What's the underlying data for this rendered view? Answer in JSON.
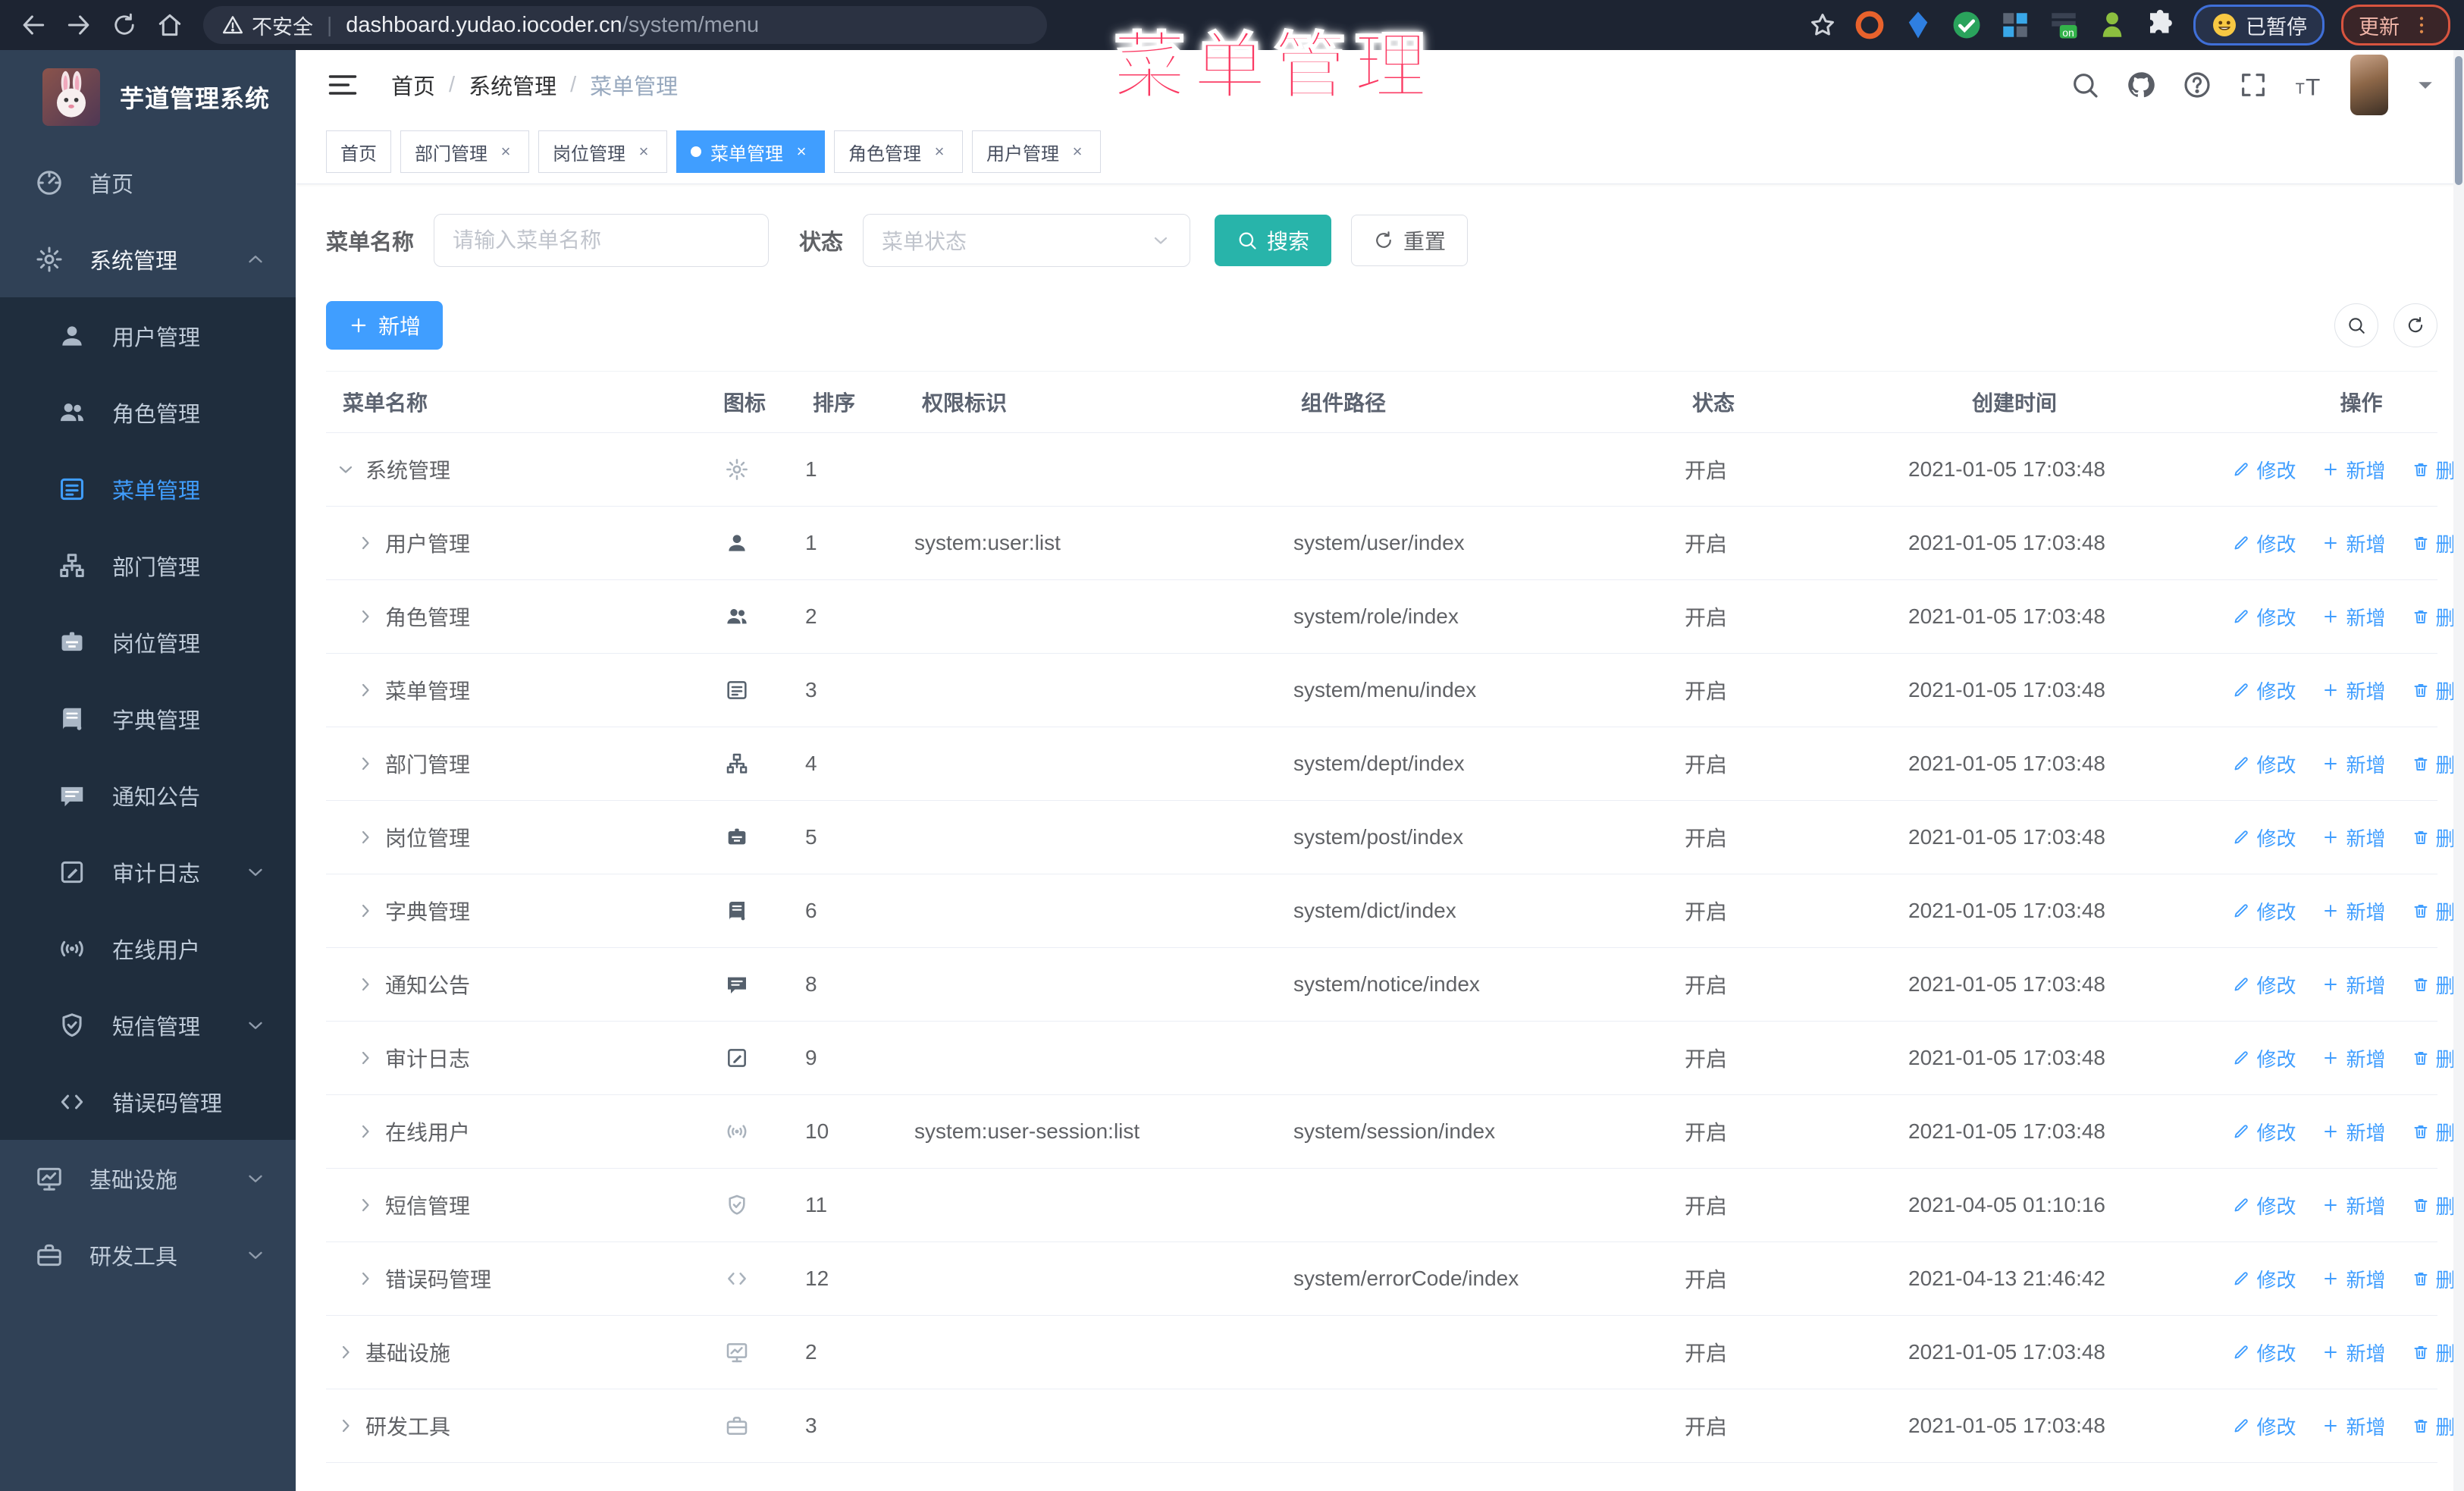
{
  "browser": {
    "security_label": "不安全",
    "url_host": "dashboard.yudao.iocoder.cn",
    "url_path": "/system/menu",
    "paused_badge": "已暂停",
    "update_badge": "更新"
  },
  "overlay": {
    "title": "菜单管理"
  },
  "sidebar": {
    "title": "芋道管理系统",
    "items": [
      {
        "label": "首页",
        "icon": "dashboard",
        "level": "root"
      },
      {
        "label": "系统管理",
        "icon": "gear",
        "level": "root",
        "open": true,
        "chevron": "up"
      },
      {
        "label": "用户管理",
        "icon": "user",
        "level": "sub"
      },
      {
        "label": "角色管理",
        "icon": "users",
        "level": "sub"
      },
      {
        "label": "菜单管理",
        "icon": "menu",
        "level": "sub",
        "active": true
      },
      {
        "label": "部门管理",
        "icon": "tree",
        "level": "sub"
      },
      {
        "label": "岗位管理",
        "icon": "idcard",
        "level": "sub"
      },
      {
        "label": "字典管理",
        "icon": "book",
        "level": "sub"
      },
      {
        "label": "通知公告",
        "icon": "message",
        "level": "sub"
      },
      {
        "label": "审计日志",
        "icon": "edit",
        "level": "sub",
        "chevron": "down"
      },
      {
        "label": "在线用户",
        "icon": "online",
        "level": "sub"
      },
      {
        "label": "短信管理",
        "icon": "shield",
        "level": "sub",
        "chevron": "down"
      },
      {
        "label": "错误码管理",
        "icon": "code",
        "level": "sub"
      },
      {
        "label": "基础设施",
        "icon": "monitor",
        "level": "root",
        "chevron": "down"
      },
      {
        "label": "研发工具",
        "icon": "toolbox",
        "level": "root",
        "chevron": "down"
      }
    ]
  },
  "breadcrumb": [
    "首页",
    "系统管理",
    "菜单管理"
  ],
  "tabs": [
    {
      "label": "首页",
      "closable": false,
      "active": false
    },
    {
      "label": "部门管理",
      "closable": true,
      "active": false
    },
    {
      "label": "岗位管理",
      "closable": true,
      "active": false
    },
    {
      "label": "菜单管理",
      "closable": true,
      "active": true
    },
    {
      "label": "角色管理",
      "closable": true,
      "active": false
    },
    {
      "label": "用户管理",
      "closable": true,
      "active": false
    }
  ],
  "filters": {
    "name_label": "菜单名称",
    "name_placeholder": "请输入菜单名称",
    "status_label": "状态",
    "status_placeholder": "菜单状态",
    "search_label": "搜索",
    "reset_label": "重置"
  },
  "toolbar": {
    "add_label": "新增"
  },
  "table": {
    "columns": [
      "菜单名称",
      "图标",
      "排序",
      "权限标识",
      "组件路径",
      "状态",
      "创建时间",
      "操作"
    ],
    "ops": [
      {
        "label": "修改",
        "icon": "pencil"
      },
      {
        "label": "新增",
        "icon": "plus"
      },
      {
        "label": "删除",
        "icon": "trash"
      }
    ],
    "rows": [
      {
        "name": "系统管理",
        "icon": "gear",
        "icon_style": "light",
        "level": 0,
        "expand": "down",
        "sort": "1",
        "perm": "",
        "path": "",
        "status": "开启",
        "time": "2021-01-05 17:03:48"
      },
      {
        "name": "用户管理",
        "icon": "user",
        "icon_style": "dark",
        "level": 1,
        "expand": "right",
        "sort": "1",
        "perm": "system:user:list",
        "path": "system/user/index",
        "status": "开启",
        "time": "2021-01-05 17:03:48"
      },
      {
        "name": "角色管理",
        "icon": "users",
        "icon_style": "dark",
        "level": 1,
        "expand": "right",
        "sort": "2",
        "perm": "",
        "path": "system/role/index",
        "status": "开启",
        "time": "2021-01-05 17:03:48"
      },
      {
        "name": "菜单管理",
        "icon": "menu",
        "icon_style": "dark",
        "level": 1,
        "expand": "right",
        "sort": "3",
        "perm": "",
        "path": "system/menu/index",
        "status": "开启",
        "time": "2021-01-05 17:03:48"
      },
      {
        "name": "部门管理",
        "icon": "tree",
        "icon_style": "dark",
        "level": 1,
        "expand": "right",
        "sort": "4",
        "perm": "",
        "path": "system/dept/index",
        "status": "开启",
        "time": "2021-01-05 17:03:48"
      },
      {
        "name": "岗位管理",
        "icon": "idcard",
        "icon_style": "dark",
        "level": 1,
        "expand": "right",
        "sort": "5",
        "perm": "",
        "path": "system/post/index",
        "status": "开启",
        "time": "2021-01-05 17:03:48"
      },
      {
        "name": "字典管理",
        "icon": "book",
        "icon_style": "dark",
        "level": 1,
        "expand": "right",
        "sort": "6",
        "perm": "",
        "path": "system/dict/index",
        "status": "开启",
        "time": "2021-01-05 17:03:48"
      },
      {
        "name": "通知公告",
        "icon": "message",
        "icon_style": "dark",
        "level": 1,
        "expand": "right",
        "sort": "8",
        "perm": "",
        "path": "system/notice/index",
        "status": "开启",
        "time": "2021-01-05 17:03:48"
      },
      {
        "name": "审计日志",
        "icon": "edit",
        "icon_style": "dark",
        "level": 1,
        "expand": "right",
        "sort": "9",
        "perm": "",
        "path": "",
        "status": "开启",
        "time": "2021-01-05 17:03:48"
      },
      {
        "name": "在线用户",
        "icon": "online",
        "icon_style": "light",
        "level": 1,
        "expand": "right",
        "sort": "10",
        "perm": "system:user-session:list",
        "path": "system/session/index",
        "status": "开启",
        "time": "2021-01-05 17:03:48"
      },
      {
        "name": "短信管理",
        "icon": "shield",
        "icon_style": "light",
        "level": 1,
        "expand": "right",
        "sort": "11",
        "perm": "",
        "path": "",
        "status": "开启",
        "time": "2021-04-05 01:10:16"
      },
      {
        "name": "错误码管理",
        "icon": "code",
        "icon_style": "light",
        "level": 1,
        "expand": "right",
        "sort": "12",
        "perm": "",
        "path": "system/errorCode/index",
        "status": "开启",
        "time": "2021-04-13 21:46:42"
      },
      {
        "name": "基础设施",
        "icon": "monitor",
        "icon_style": "light",
        "level": 0,
        "expand": "right",
        "sort": "2",
        "perm": "",
        "path": "",
        "status": "开启",
        "time": "2021-01-05 17:03:48"
      },
      {
        "name": "研发工具",
        "icon": "toolbox",
        "icon_style": "light",
        "level": 0,
        "expand": "right",
        "sort": "3",
        "perm": "",
        "path": "",
        "status": "开启",
        "time": "2021-01-05 17:03:48"
      }
    ]
  },
  "colors": {
    "accent": "#409eff",
    "search_button": "#28b4aa",
    "overlay_pink": "#fb3a63",
    "sidebar_bg": "#304156",
    "submenu_bg": "#1f2d3d"
  }
}
